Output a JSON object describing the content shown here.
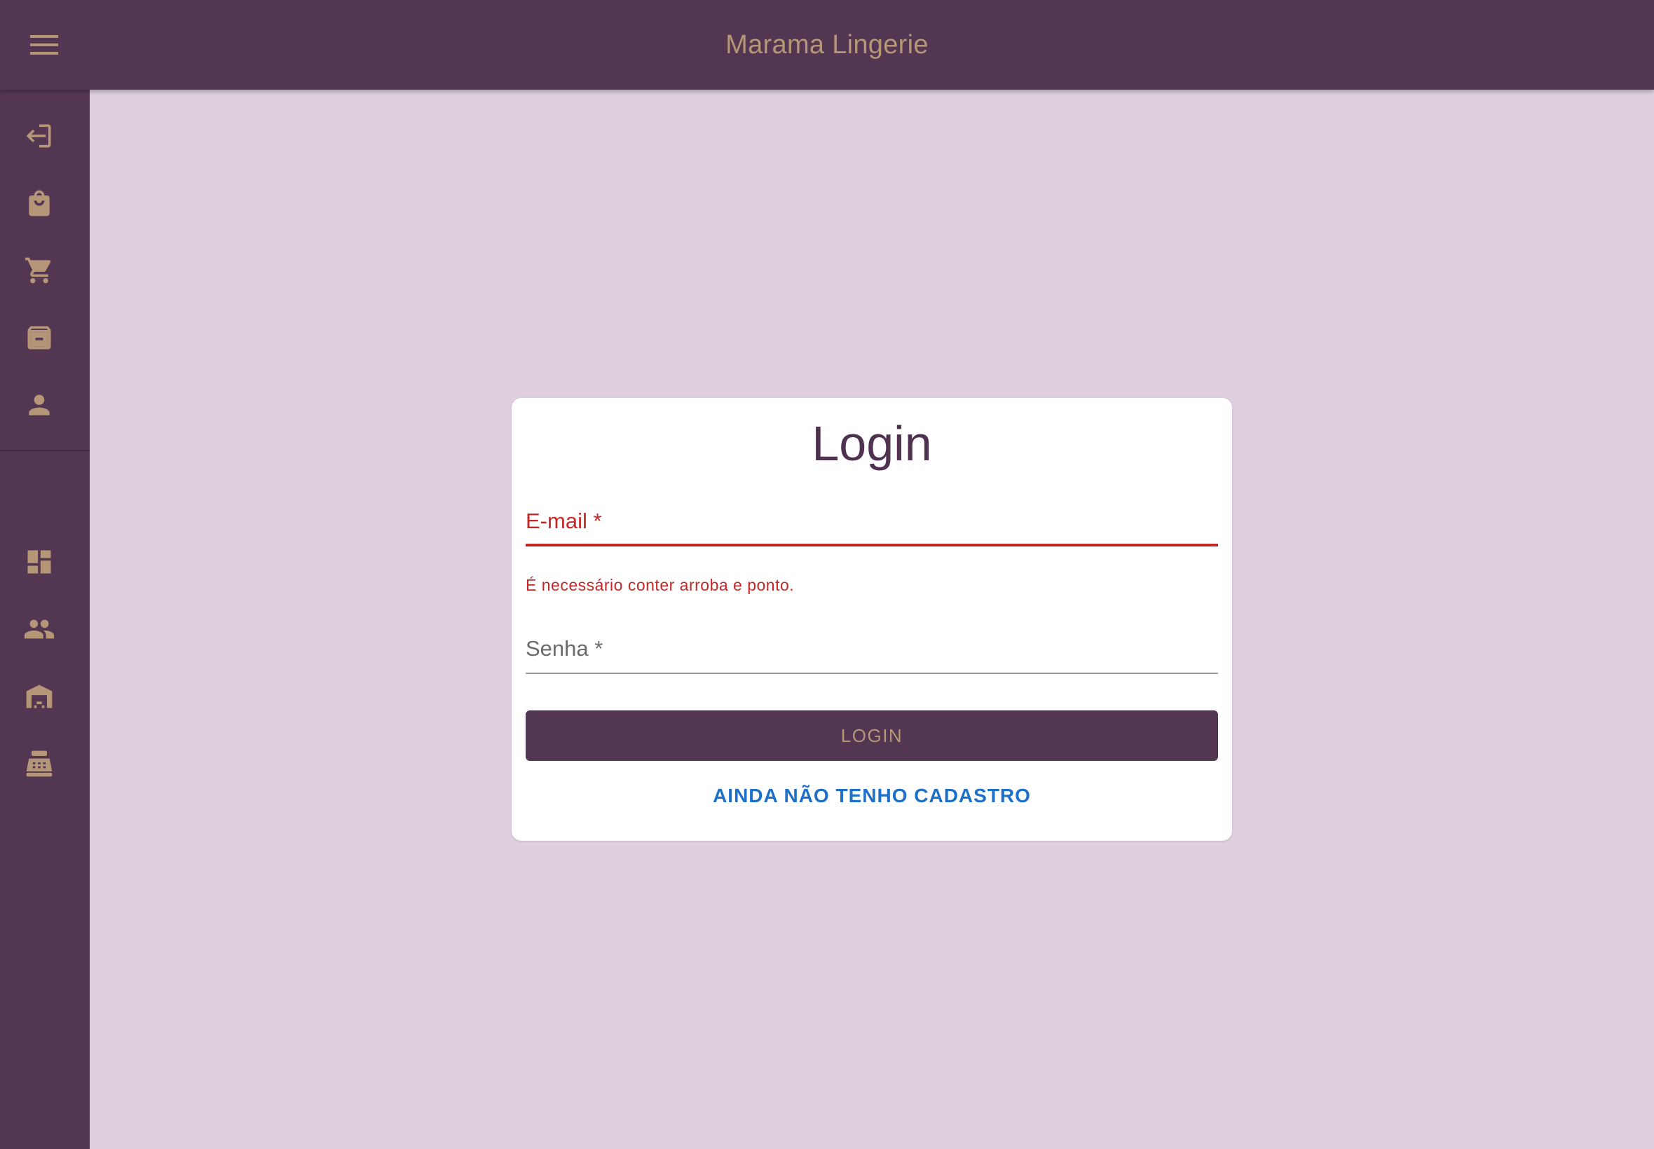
{
  "app": {
    "title": "Marama Lingerie",
    "colors": {
      "bar": "#533652",
      "accent": "#b59676",
      "background": "#dfcfdf",
      "error": "#c62828",
      "link": "#1e6fc8"
    }
  },
  "header": {
    "menu_icon": "menu-icon"
  },
  "sidebar": {
    "items": [
      {
        "icon": "login-icon"
      },
      {
        "icon": "shopping-bag-icon"
      },
      {
        "icon": "cart-icon"
      },
      {
        "icon": "archive-icon"
      },
      {
        "icon": "person-icon"
      },
      {
        "icon": "dashboard-icon"
      },
      {
        "icon": "people-icon"
      },
      {
        "icon": "warehouse-icon"
      },
      {
        "icon": "cash-register-icon"
      }
    ]
  },
  "login_card": {
    "title": "Login",
    "email": {
      "label": "E-mail *",
      "value": "",
      "error": "É necessário conter arroba e ponto."
    },
    "password": {
      "label": "Senha *",
      "value": ""
    },
    "submit_label": "LOGIN",
    "register_link": "AINDA NÃO TENHO CADASTRO"
  }
}
